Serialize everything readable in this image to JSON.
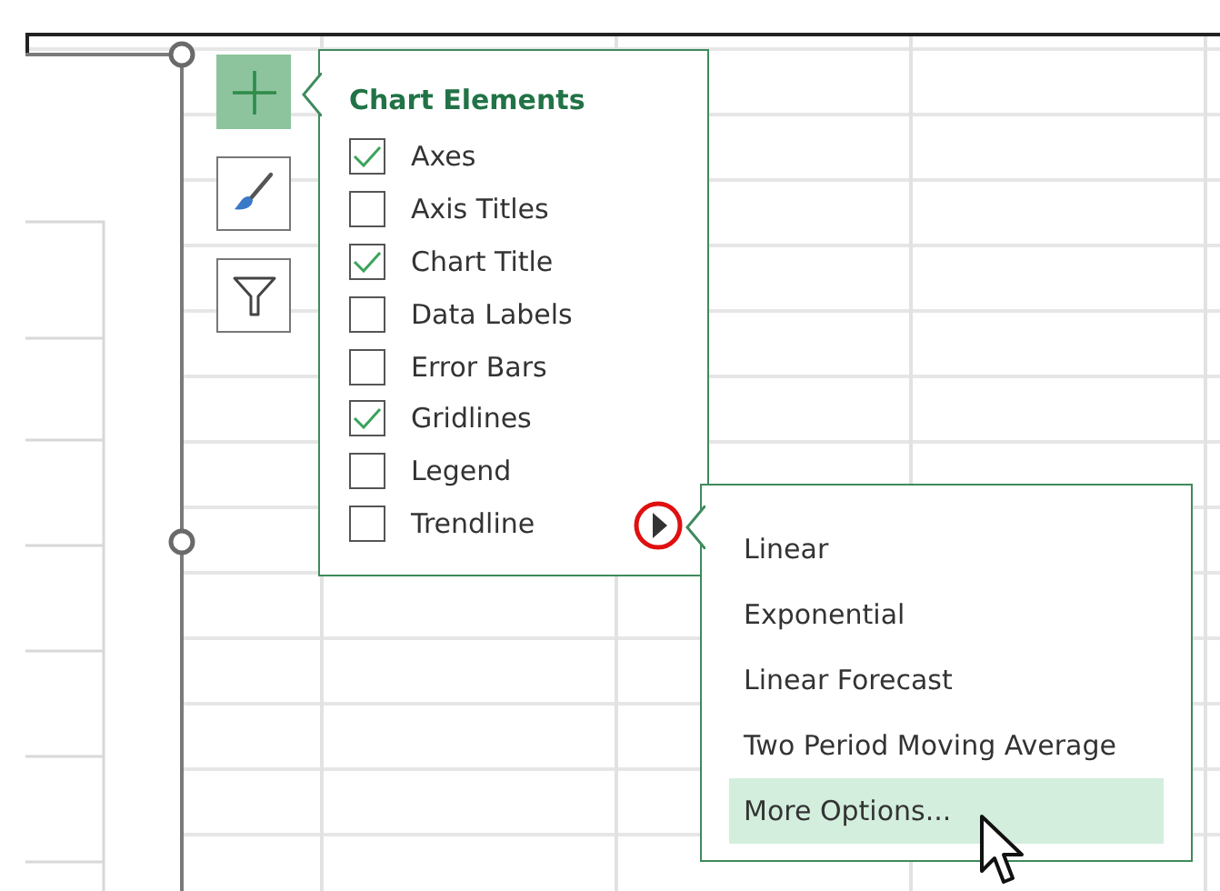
{
  "chart_buttons": [
    {
      "kind": "add",
      "selected": true
    },
    {
      "kind": "style",
      "selected": false
    },
    {
      "kind": "filter",
      "selected": false
    }
  ],
  "chart_elements": {
    "title": "Chart Elements",
    "items": [
      {
        "label": "Axes",
        "checked": true
      },
      {
        "label": "Axis Titles",
        "checked": false
      },
      {
        "label": "Chart Title",
        "checked": true
      },
      {
        "label": "Data Labels",
        "checked": false
      },
      {
        "label": "Error Bars",
        "checked": false
      },
      {
        "label": "Gridlines",
        "checked": true
      },
      {
        "label": "Legend",
        "checked": false
      },
      {
        "label": "Trendline",
        "checked": false
      }
    ]
  },
  "trendline_menu": {
    "items": [
      {
        "label": "Linear",
        "selected": false
      },
      {
        "label": "Exponential",
        "selected": false
      },
      {
        "label": "Linear Forecast",
        "selected": false
      },
      {
        "label": "Two Period Moving Average",
        "selected": false
      },
      {
        "label": "More Options...",
        "selected": true
      }
    ]
  }
}
